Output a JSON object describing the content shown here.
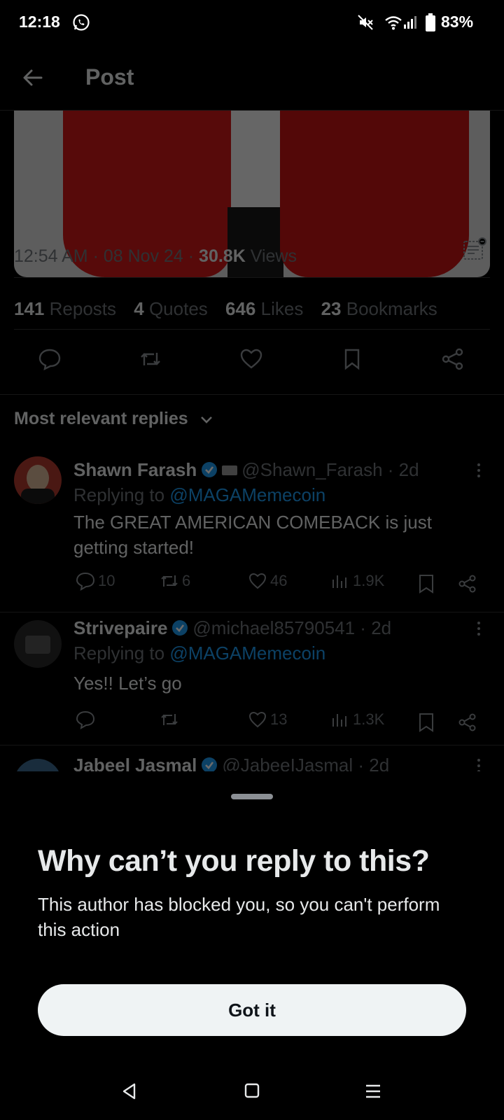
{
  "status_bar": {
    "time": "12:18",
    "battery": "83%"
  },
  "header": {
    "title": "Post"
  },
  "post": {
    "time": "12:54 AM",
    "date": "08 Nov 24",
    "views_count": "30.8K",
    "views_label": "Views",
    "reposts_count": "141",
    "reposts_label": "Reposts",
    "quotes_count": "4",
    "quotes_label": "Quotes",
    "likes_count": "646",
    "likes_label": "Likes",
    "bookmarks_count": "23",
    "bookmarks_label": "Bookmarks"
  },
  "replies_sort": {
    "label": "Most relevant replies"
  },
  "replies": [
    {
      "name": "Shawn Farash",
      "handle": "@Shawn_Farash",
      "age": "2d",
      "replying_to_label": "Replying to",
      "mention": "@MAGAMemecoin",
      "text": "The GREAT AMERICAN COMEBACK is just getting started!",
      "reply_count": "10",
      "repost_count": "6",
      "like_count": "46",
      "view_count": "1.9K"
    },
    {
      "name": "Strivepaire",
      "handle": "@michael85790541",
      "age": "2d",
      "replying_to_label": "Replying to",
      "mention": "@MAGAMemecoin",
      "text": "Yes!! Let’s go",
      "reply_count": "",
      "repost_count": "",
      "like_count": "13",
      "view_count": "1.3K"
    },
    {
      "name": "Jabeel Jasmal",
      "handle": "@JabeeIJasmal",
      "age": "2d"
    }
  ],
  "sheet": {
    "title": "Why can’t you reply to this?",
    "body": "This author has blocked you, so you can't perform this action",
    "button_label": "Got it"
  },
  "colors": {
    "accent": "#1d9bf0",
    "background": "#000000",
    "button_bg": "#eff3f4"
  }
}
